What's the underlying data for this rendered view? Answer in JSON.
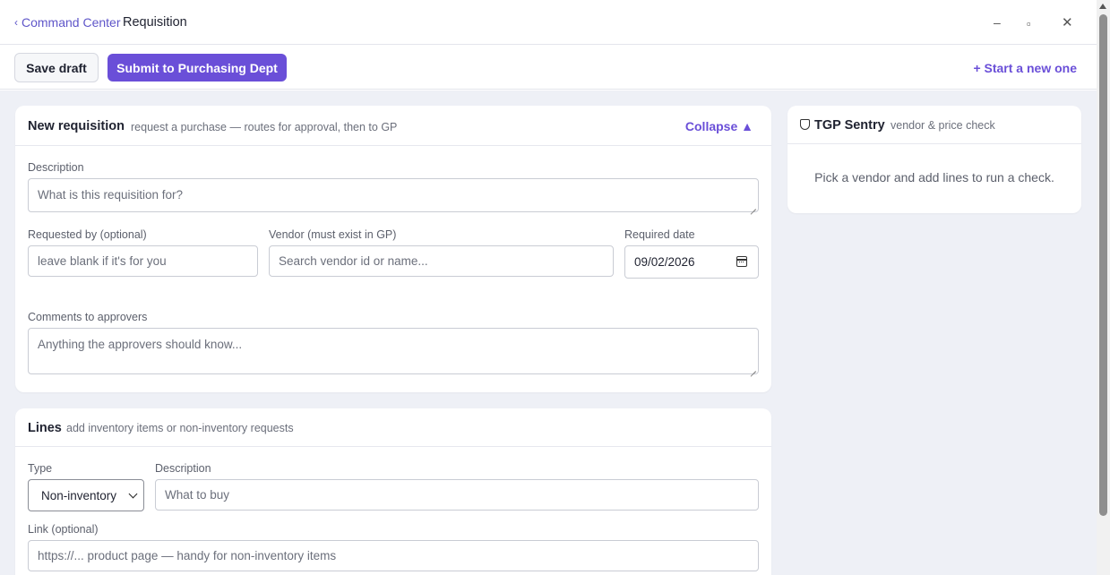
{
  "nav": {
    "back_chevron": "‹",
    "back_label": "Command Center",
    "title": "Requisition"
  },
  "window": {
    "minimize": "–",
    "maximize": "▫",
    "close": "✕"
  },
  "toolbar": {
    "save_label": "Save draft",
    "submit_label": "Submit to Purchasing Dept",
    "start_new_label": "+ Start a new one"
  },
  "requisition": {
    "title": "New requisition",
    "subtitle": "request a purchase — routes for approval, then to GP",
    "collapse_label": "Collapse ▲",
    "description_label": "Description",
    "description_placeholder": "What is this requisition for?",
    "requested_by_label": "Requested by (optional)",
    "requested_by_placeholder": "leave blank if it's for you",
    "vendor_label": "Vendor (must exist in GP)",
    "vendor_placeholder": "Search vendor id or name...",
    "required_date_label": "Required date",
    "required_date_value": "09/02/2026",
    "comments_label": "Comments to approvers",
    "comments_placeholder": "Anything the approvers should know..."
  },
  "lines": {
    "title": "Lines",
    "subtitle": "add inventory items or non-inventory requests",
    "type_label": "Type",
    "type_value": "Non-inventory",
    "description_label": "Description",
    "description_placeholder": "What to buy",
    "link_label": "Link (optional)",
    "link_placeholder": "https://... product page — handy for non-inventory items"
  },
  "sentry": {
    "title": "TGP Sentry",
    "subtitle": "vendor & price check",
    "message": "Pick a vendor and add lines to run a check."
  },
  "colors": {
    "accent": "#6a4fd8",
    "canvas": "#eef0f6"
  }
}
